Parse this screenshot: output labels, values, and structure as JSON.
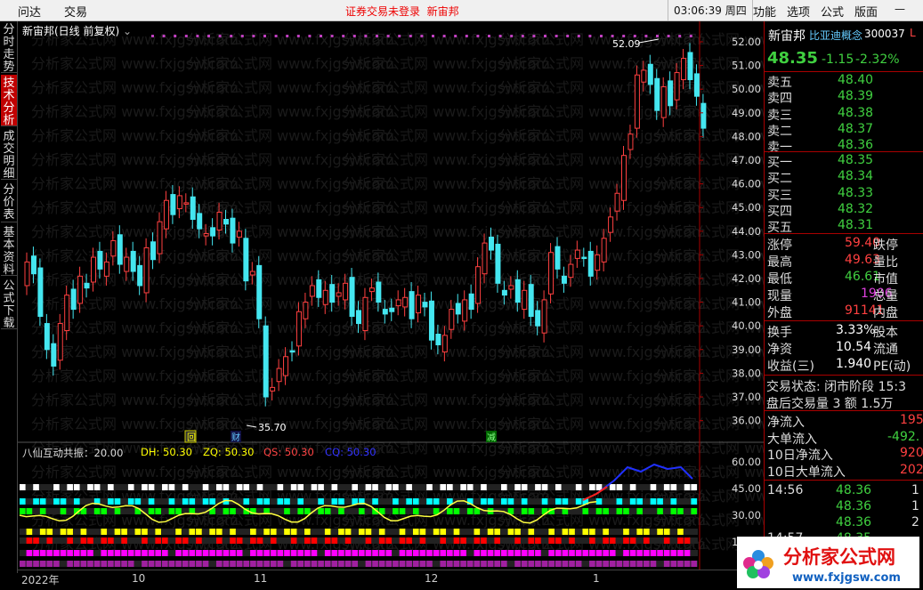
{
  "topbar": {
    "menu": [
      "问达",
      "交易"
    ],
    "status": "证券交易未登录",
    "stock_name": "新宙邦",
    "clock": "03:06:39 周四",
    "right_menu": [
      "功能",
      "选项",
      "公式",
      "版面"
    ]
  },
  "left_tabs": [
    "分时走势",
    "技术分析",
    "成交明细",
    "分价表",
    "基本资料",
    "公式下载"
  ],
  "chart_title": "新宙邦(日线 前复权)",
  "price_axis": [
    "52.00",
    "51.00",
    "50.00",
    "49.00",
    "48.00",
    "47.00",
    "46.00",
    "45.00",
    "44.00",
    "43.00",
    "42.00",
    "41.00",
    "40.00",
    "39.00",
    "38.00",
    "37.00",
    "36.00"
  ],
  "annotations": {
    "high": "52.09",
    "low": "35.70",
    "markers": [
      "回",
      "财",
      "减"
    ]
  },
  "indicator": {
    "name": "八仙互动共振：20.00",
    "dh": "DH: 50.30",
    "zq": "ZQ: 50.30",
    "qs": "QS: 50.30",
    "cq": "CQ: 50.30",
    "axis": [
      "60.00",
      "45.00",
      "30.00",
      "15.00"
    ]
  },
  "date_axis": [
    "2022年",
    "10",
    "11",
    "12",
    "1"
  ],
  "quote": {
    "name": "新宙邦",
    "concept": "比亚迪概念",
    "code": "300037",
    "flag": "L",
    "price": "48.35",
    "change": "-1.15",
    "pct": "-2.32%",
    "asks": [
      [
        "卖五",
        "48.40"
      ],
      [
        "卖四",
        "48.39"
      ],
      [
        "卖三",
        "48.38"
      ],
      [
        "卖二",
        "48.37"
      ],
      [
        "卖一",
        "48.36"
      ]
    ],
    "bids": [
      [
        "买一",
        "48.35"
      ],
      [
        "买二",
        "48.34"
      ],
      [
        "买三",
        "48.33"
      ],
      [
        "买四",
        "48.32"
      ],
      [
        "买五",
        "48.31"
      ]
    ],
    "stats": [
      [
        "涨停",
        "59.40",
        "跌停"
      ],
      [
        "最高",
        "49.63",
        "量比"
      ],
      [
        "最低",
        "46.61",
        "市值"
      ],
      [
        "现量",
        "1906",
        "总量"
      ],
      [
        "外盘",
        "91141",
        "内盘"
      ]
    ],
    "stats2": [
      [
        "换手",
        "3.33%",
        "股本"
      ],
      [
        "净资",
        "10.54",
        "流通"
      ],
      [
        "收益(三)",
        "1.940",
        "PE(动)"
      ]
    ],
    "trade_state": "交易状态: 闭市阶段 15:3",
    "after_hours": "盘后交易量 3 额 1.5万",
    "flows": [
      [
        "净流入",
        "195"
      ],
      [
        "大单流入",
        "-492."
      ],
      [
        "10日净流入",
        "920"
      ],
      [
        "10日大单流入",
        "202"
      ]
    ],
    "ticks": [
      [
        "14:56",
        "48.36",
        "1"
      ],
      [
        "",
        "48.36",
        "1"
      ],
      [
        "",
        "48.36",
        "2"
      ],
      [
        "14:57",
        "48.35",
        ""
      ]
    ]
  },
  "logo": {
    "text": "分析家公式网",
    "url": "www.fxjgsw.com"
  },
  "watermark": "分析家公式网 www.fxjgsw.com"
}
